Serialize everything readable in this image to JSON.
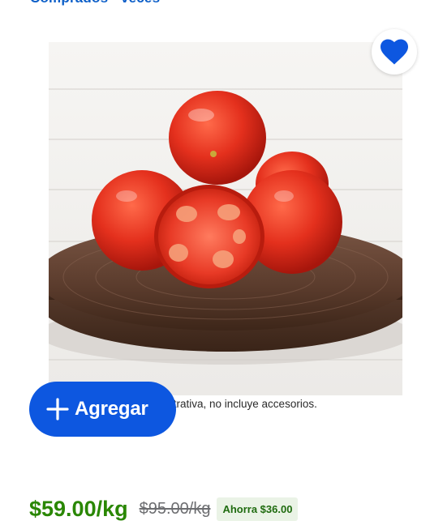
{
  "breadcrumb_link": "Comprados · veces",
  "product": {
    "image_alt": "Jitomate saladet",
    "image_caption": "strativa, no incluye accesorios."
  },
  "actions": {
    "add_label": "Agregar",
    "add_icon": "plus-icon",
    "favorite_icon": "heart-icon",
    "favorite_color": "#0d57e0"
  },
  "pricing": {
    "current": "$59.00/kg",
    "previous": "$95.00/kg",
    "savings": "Ahorra $36.00",
    "current_color": "#2a8703",
    "button_color": "#0d57e0"
  }
}
